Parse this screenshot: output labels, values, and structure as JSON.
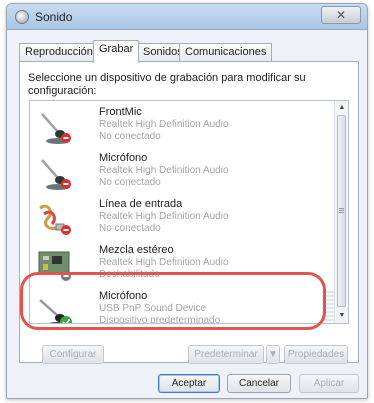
{
  "window": {
    "title": "Sonido",
    "close_glyph": "✕"
  },
  "tabs": [
    {
      "label": "Reproducción",
      "active": false
    },
    {
      "label": "Grabar",
      "active": true
    },
    {
      "label": "Sonidos",
      "active": false
    },
    {
      "label": "Comunicaciones",
      "active": false
    }
  ],
  "instruction": "Seleccione un dispositivo de grabación para modificar su configuración:",
  "devices": [
    {
      "name": "FrontMic",
      "line1": "Realtek High Definition Audio",
      "line2": "No conectado",
      "icon": "microphone-icon",
      "status": "disconnected"
    },
    {
      "name": "Micrófono",
      "line1": "Realtek High Definition Audio",
      "line2": "No conectado",
      "icon": "microphone-icon",
      "status": "disconnected"
    },
    {
      "name": "Línea de entrada",
      "line1": "Realtek High Definition Audio",
      "line2": "No conectado",
      "icon": "line-in-cable-icon",
      "status": "disconnected"
    },
    {
      "name": "Mezcla estéreo",
      "line1": "Realtek High Definition Audio",
      "line2": "Deshabilitado",
      "icon": "circuit-board-icon",
      "status": "disabled"
    },
    {
      "name": "Micrófono",
      "line1": "USB PnP Sound Device",
      "line2": "Dispositivo predeterminado",
      "icon": "microphone-icon",
      "status": "default"
    }
  ],
  "buttons": {
    "configure": "Configurar",
    "set_default": "Predeterminar",
    "set_default_arrow": "▼",
    "properties": "Propiedades",
    "accept": "Aceptar",
    "cancel": "Cancelar",
    "apply": "Aplicar"
  },
  "scroll": {
    "up": "▲",
    "down": "▼"
  },
  "colors": {
    "highlight_ring": "#e5534b",
    "status_disconnected": "#d9302c",
    "status_default": "#3aa63f"
  }
}
